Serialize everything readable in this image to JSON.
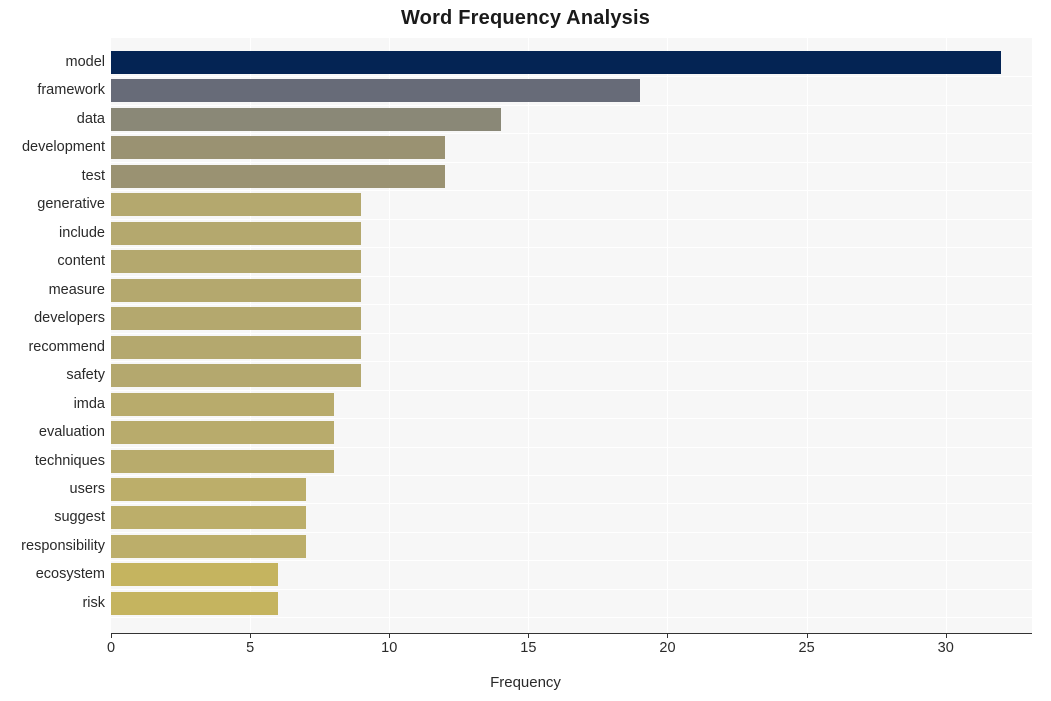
{
  "chart_data": {
    "type": "bar",
    "orientation": "horizontal",
    "title": "Word Frequency Analysis",
    "xlabel": "Frequency",
    "ylabel": "",
    "categories": [
      "model",
      "framework",
      "data",
      "development",
      "test",
      "generative",
      "include",
      "content",
      "measure",
      "developers",
      "recommend",
      "safety",
      "imda",
      "evaluation",
      "techniques",
      "users",
      "suggest",
      "responsibility",
      "ecosystem",
      "risk"
    ],
    "values": [
      32,
      19,
      14,
      12,
      12,
      9,
      9,
      9,
      9,
      9,
      9,
      9,
      8,
      8,
      8,
      7,
      7,
      7,
      6,
      6
    ],
    "bar_colors": [
      "#042454",
      "#676b78",
      "#8a8877",
      "#9a9272",
      "#9a9272",
      "#b4a86e",
      "#b4a86e",
      "#b4a86e",
      "#b4a86e",
      "#b4a86e",
      "#b4a86e",
      "#b4a86e",
      "#b8ab6c",
      "#b8ab6c",
      "#b8ab6c",
      "#bcae6a",
      "#bcae6a",
      "#bcae6a",
      "#c5b45f",
      "#c5b45f"
    ],
    "xlim": [
      0,
      33.1
    ],
    "xticks": [
      0,
      5,
      10,
      15,
      20,
      25,
      30
    ],
    "xtick_labels": [
      "0",
      "5",
      "10",
      "15",
      "20",
      "25",
      "30"
    ],
    "grid": true,
    "legend": false,
    "plot_background": "#f7f7f7",
    "figure_background": "#ffffff"
  }
}
